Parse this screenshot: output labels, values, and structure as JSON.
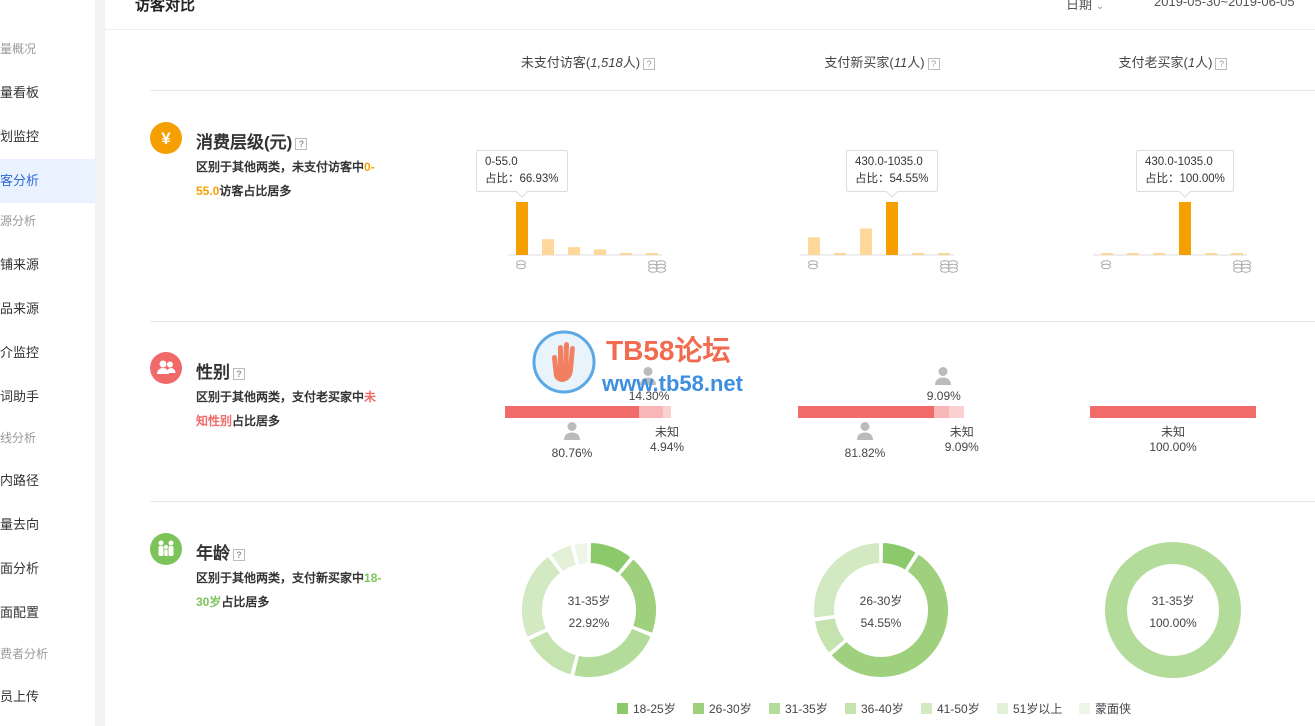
{
  "sidebar": {
    "items": [
      {
        "type": "section",
        "label": "量概况"
      },
      {
        "type": "item",
        "label": "量看板"
      },
      {
        "type": "item",
        "label": "划监控"
      },
      {
        "type": "item",
        "label": "客分析",
        "active": true
      },
      {
        "type": "section",
        "label": "源分析"
      },
      {
        "type": "item",
        "label": "铺来源"
      },
      {
        "type": "item",
        "label": "品来源"
      },
      {
        "type": "item",
        "label": "介监控"
      },
      {
        "type": "item",
        "label": "词助手"
      },
      {
        "type": "section",
        "label": "线分析"
      },
      {
        "type": "item",
        "label": "内路径"
      },
      {
        "type": "item",
        "label": "量去向"
      },
      {
        "type": "item",
        "label": "面分析"
      },
      {
        "type": "item",
        "label": "面配置"
      },
      {
        "type": "section",
        "label": "费者分析"
      },
      {
        "type": "item",
        "label": "员上传"
      }
    ]
  },
  "header": {
    "title": "访客对比",
    "date_label": "日期",
    "date_range": "2019-05-30~2019-06-05"
  },
  "columns": [
    {
      "label_prefix": "未支付访客(",
      "count": "1,518",
      "label_suffix": "人)"
    },
    {
      "label_prefix": "支付新买家(",
      "count": "11",
      "label_suffix": "人)"
    },
    {
      "label_prefix": "支付老买家(",
      "count": "1",
      "label_suffix": "人)"
    }
  ],
  "sections": {
    "spend": {
      "title": "消费层级(元)",
      "icon": "yen-icon",
      "color": "#f5a000",
      "desc_before": "区别于其他两类，未支付访客中",
      "desc_highlight": "0-55.0",
      "desc_after": "访客占比居多",
      "charts": [
        {
          "tooltip_range": "0-55.0",
          "tooltip_share": "占比：66.93%",
          "highlight": 0,
          "values": [
            66.93,
            20.0,
            10.0,
            7.0,
            2.0,
            2.0
          ]
        },
        {
          "tooltip_range": "430.0-1035.0",
          "tooltip_share": "占比：54.55%",
          "highlight": 3,
          "values": [
            18.18,
            0,
            27.27,
            54.55,
            0,
            0
          ]
        },
        {
          "tooltip_range": "430.0-1035.0",
          "tooltip_share": "占比：100.00%",
          "highlight": 3,
          "values": [
            0,
            0,
            0,
            100.0,
            0,
            0
          ]
        }
      ]
    },
    "gender": {
      "title": "性别",
      "icon": "users-icon",
      "color": "#f06a6a",
      "desc_before": "区别于其他两类，支付老买家中",
      "desc_highlight": "未知性别",
      "desc_after": "占比居多",
      "columns": [
        {
          "male": "80.76%",
          "female": "14.30%",
          "unknown_label": "未知",
          "unknown": "4.94%",
          "shares": [
            80.76,
            14.3,
            4.94
          ]
        },
        {
          "male": "81.82%",
          "female": "9.09%",
          "unknown_label": "未知",
          "unknown": "9.09%",
          "shares": [
            81.82,
            9.09,
            9.09
          ]
        },
        {
          "male": "",
          "female": "",
          "unknown_label": "未知",
          "unknown": "100.00%",
          "shares": [
            100.0,
            0,
            0
          ]
        }
      ]
    },
    "age": {
      "title": "年龄",
      "icon": "family-icon",
      "color": "#7cc35a",
      "desc_before": "区别于其他两类，支付新买家中",
      "desc_highlight": "18-30岁",
      "desc_after": "占比居多",
      "donuts": [
        {
          "center_label": "31-35岁",
          "center_value": "22.92%",
          "values": [
            11,
            20,
            23,
            14,
            22,
            6,
            4
          ]
        },
        {
          "center_label": "26-30岁",
          "center_value": "54.55%",
          "values": [
            9.09,
            54.55,
            0,
            9.09,
            27.27,
            0,
            0
          ]
        },
        {
          "center_label": "31-35岁",
          "center_value": "100.00%",
          "values": [
            0,
            0,
            100,
            0,
            0,
            0,
            0
          ]
        }
      ],
      "legend": [
        {
          "label": "18-25岁",
          "color": "#8bc96a"
        },
        {
          "label": "26-30岁",
          "color": "#9ed07e"
        },
        {
          "label": "31-35岁",
          "color": "#b3db99"
        },
        {
          "label": "36-40岁",
          "color": "#c4e3ae"
        },
        {
          "label": "41-50岁",
          "color": "#d3e9c2"
        },
        {
          "label": "51岁以上",
          "color": "#e1f0d6"
        },
        {
          "label": "蒙面侠",
          "color": "#edf6e6"
        }
      ]
    }
  },
  "watermark": {
    "title": "TB58论坛",
    "url": "www.tb58.net"
  }
}
